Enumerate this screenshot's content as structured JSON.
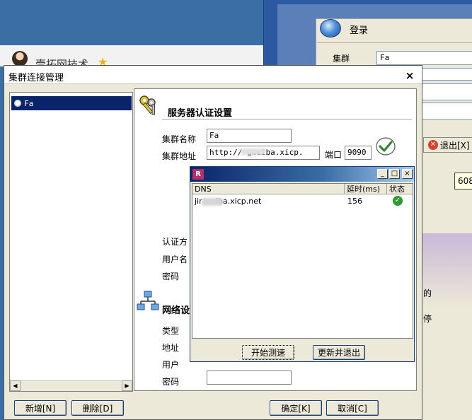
{
  "background": {
    "login": {
      "title": "登录",
      "cluster_label": "集群",
      "cluster_value": "Fa",
      "exit_button": "退出[X]",
      "tooltip": "608",
      "side_text_1": "的",
      "side_text_2": "停"
    },
    "contact_name": "壹拓网技术",
    "star": "★"
  },
  "dialog": {
    "title": "集群连接管理",
    "close": "×",
    "tree": {
      "items": [
        {
          "label": "Fa"
        }
      ],
      "scroll_left": "◀",
      "scroll_right": "▶"
    },
    "auth_section": {
      "title": "服务器认证设置",
      "cluster_name_label": "集群名称",
      "cluster_name_value": "Fa",
      "cluster_addr_label": "集群地址",
      "cluster_addr_value": "http://       gweiba.xicp.",
      "port_label": "端口",
      "port_value": "9090",
      "auth_method_label": "认证方",
      "username_label": "用户名",
      "password_label": "密码"
    },
    "net_section": {
      "title": "网络设",
      "type_label": "类型",
      "address_label": "地址",
      "user_label": "用户",
      "password_label": "密码"
    },
    "buttons": {
      "add": "新增[N]",
      "delete": "删除[D]",
      "ok": "确定[K]",
      "cancel": "取消[C]"
    }
  },
  "dns_popup": {
    "app_icon": "R",
    "min": "_",
    "max": "□",
    "close": "×",
    "columns": [
      "DNS",
      "延时(ms)",
      "状态"
    ],
    "rows": [
      {
        "dns": "jir       weiba.xicp.net",
        "latency": "156",
        "status_icon": "check-ok"
      }
    ],
    "start_test_button": "开始测速",
    "update_exit_button": "更新并退出"
  }
}
